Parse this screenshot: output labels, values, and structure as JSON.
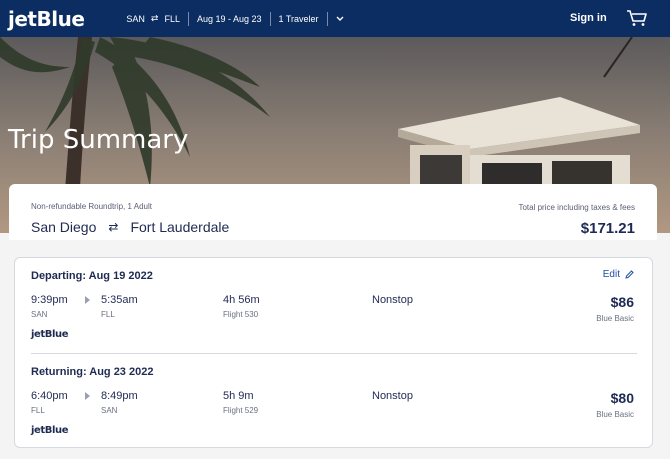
{
  "nav": {
    "logo": "jetBlue",
    "origin": "SAN",
    "destination": "FLL",
    "dates": "Aug 19 - Aug 23",
    "travelers": "1 Traveler",
    "signin_label": "Sign in",
    "swap_icon": "⇄",
    "chevron_icon": "⌄"
  },
  "hero": {
    "title": "Trip Summary"
  },
  "summary": {
    "subtitle": "Non-refundable Roundtrip, 1 Adult",
    "from_city": "San Diego",
    "to_city": "Fort Lauderdale",
    "swap_icon": "⇄",
    "total_label": "Total price including taxes & fees",
    "total_price": "$171.21"
  },
  "legs": [
    {
      "heading": "Departing: Aug 19 2022",
      "edit_label": "Edit",
      "depart_time": "9:39pm",
      "depart_code": "SAN",
      "arrive_time": "5:35am",
      "arrive_code": "FLL",
      "duration": "4h 56m",
      "flight": "Flight 530",
      "stops": "Nonstop",
      "price": "$86",
      "fare": "Blue Basic",
      "carrier": "jetBlue"
    },
    {
      "heading": "Returning: Aug 23 2022",
      "depart_time": "6:40pm",
      "depart_code": "FLL",
      "arrive_time": "8:49pm",
      "arrive_code": "SAN",
      "duration": "5h 9m",
      "flight": "Flight 529",
      "stops": "Nonstop",
      "price": "$80",
      "fare": "Blue Basic",
      "carrier": "jetBlue"
    }
  ],
  "colors": {
    "nav": "#0c2d62",
    "text": "#1f2a52",
    "link": "#1f4fa8"
  }
}
